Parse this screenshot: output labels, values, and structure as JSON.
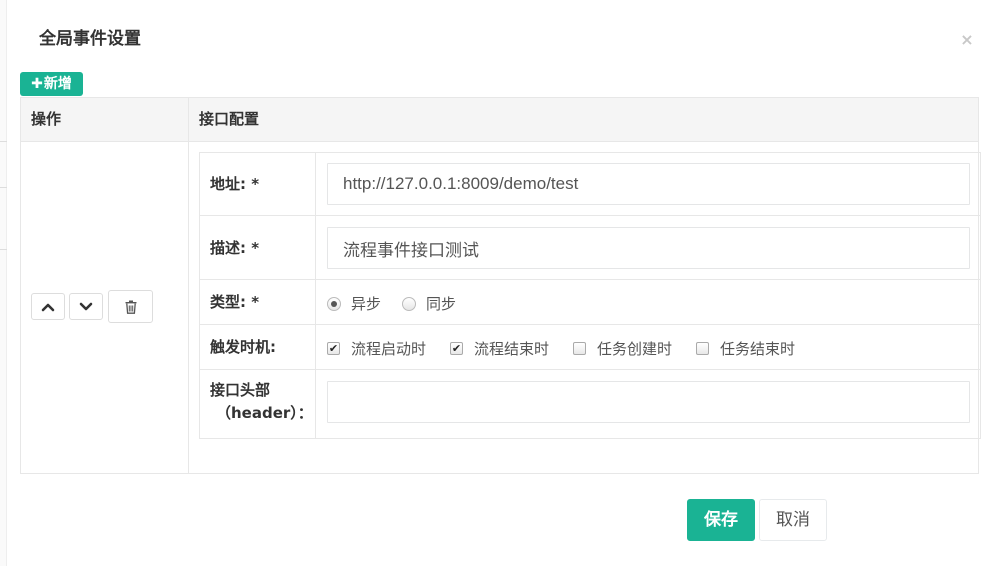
{
  "dialog": {
    "title": "全局事件设置",
    "close_icon": "×"
  },
  "toolbar": {
    "add_label": "新增",
    "add_icon": "✚"
  },
  "table": {
    "headers": [
      "操作",
      "接口配置"
    ]
  },
  "form": {
    "address": {
      "label": "地址: *",
      "value": "http://127.0.0.1:8009/demo/test"
    },
    "description": {
      "label": "描述: *",
      "value": "流程事件接口测试"
    },
    "type": {
      "label": "类型: *",
      "options": [
        {
          "label": "异步",
          "checked": true
        },
        {
          "label": "同步",
          "checked": false
        }
      ]
    },
    "trigger": {
      "label": "触发时机:",
      "options": [
        {
          "label": "流程启动时",
          "checked": true
        },
        {
          "label": "流程结束时",
          "checked": true
        },
        {
          "label": "任务创建时",
          "checked": false
        },
        {
          "label": "任务结束时",
          "checked": false
        }
      ]
    },
    "header": {
      "label_line1": "接口头部",
      "label_line2": "（header）：",
      "value": ""
    }
  },
  "footer": {
    "save_label": "保存",
    "cancel_label": "取消"
  },
  "colors": {
    "primary": "#1ab394",
    "border": "#e7e7e7",
    "header_bg": "#f5f5f5"
  }
}
